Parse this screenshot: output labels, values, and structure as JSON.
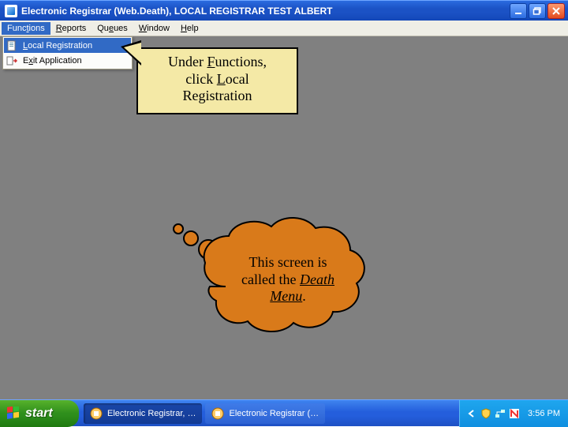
{
  "window": {
    "title": "Electronic Registrar (Web.Death), LOCAL REGISTRAR TEST   ALBERT"
  },
  "menubar": {
    "items": [
      {
        "label_pre": "Func",
        "ul": "t",
        "label_post": "ions"
      },
      {
        "label_pre": "",
        "ul": "R",
        "label_post": "eports"
      },
      {
        "label_pre": "Qu",
        "ul": "e",
        "label_post": "ues"
      },
      {
        "label_pre": "",
        "ul": "W",
        "label_post": "indow"
      },
      {
        "label_pre": "",
        "ul": "H",
        "label_post": "elp"
      }
    ]
  },
  "dropdown": {
    "items": [
      {
        "pre": "",
        "ul": "L",
        "post": "ocal Registration"
      },
      {
        "pre": "E",
        "ul": "x",
        "post": "it Application"
      }
    ]
  },
  "callout": {
    "line1_pre": "Under ",
    "line1_ul": "F",
    "line1_post": "unctions,",
    "line2_pre": "click ",
    "line2_ul": "L",
    "line2_post": "ocal",
    "line3": "Registration"
  },
  "cloud": {
    "line1": "This screen is",
    "line2_pre": "called the ",
    "line2_em": "Death",
    "line3_em": "Menu",
    "line3_post": "."
  },
  "taskbar": {
    "start": "start",
    "items": [
      {
        "label": "Electronic Registrar, …"
      },
      {
        "label": "Electronic Registrar (…"
      }
    ],
    "clock": "3:56 PM"
  },
  "colors": {
    "callout_fill": "#f4e9a6",
    "cloud_fill": "#d97a1a"
  }
}
